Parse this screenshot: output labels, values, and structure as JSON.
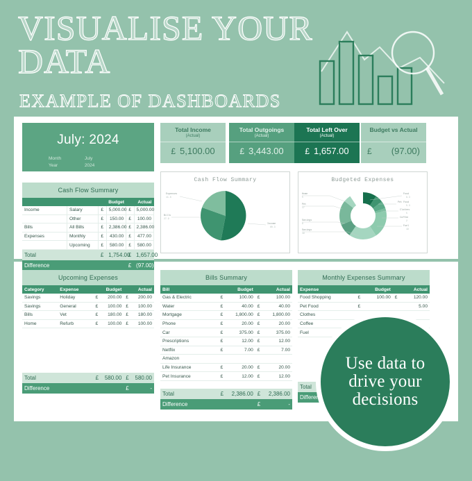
{
  "header": {
    "title": "VISUALISE YOUR\nDATA",
    "subtitle": "EXAMPLE OF  DASHBOARDS",
    "art_icon": "bar-chart-magnifier-icon"
  },
  "month_panel": {
    "title": "July: 2024",
    "rows": [
      {
        "label": "Month",
        "value": "July"
      },
      {
        "label": "Year",
        "value": "2024"
      }
    ]
  },
  "kpis": [
    {
      "title": "Total Income",
      "subtitle": "(Actual)",
      "currency": "£",
      "value": "5,100.00",
      "style": "light"
    },
    {
      "title": "Total Outgoings",
      "subtitle": "(Actual)",
      "currency": "£",
      "value": "3,443.00",
      "style": "mid"
    },
    {
      "title": "Total Left Over",
      "subtitle": "(Actual)",
      "currency": "£",
      "value": "1,657.00",
      "style": "dark"
    },
    {
      "title": "Budget vs Actual",
      "subtitle": "",
      "currency": "£",
      "value": "(97.00)",
      "style": "light"
    }
  ],
  "cashflow_table": {
    "caption": "Cash Flow Summary",
    "headers": [
      "",
      "",
      "",
      "Budget",
      "",
      "Actual"
    ],
    "rows": [
      [
        "Income",
        "Salary",
        "£",
        "5,000.00",
        "£",
        "5,000.00"
      ],
      [
        "",
        "Other",
        "£",
        "150.00",
        "£",
        "100.00"
      ],
      [
        "Bills",
        "All Bills",
        "£",
        "2,386.00",
        "£",
        "2,386.00"
      ],
      [
        "Expenses",
        "Monthly",
        "£",
        "430.00",
        "£",
        "477.00"
      ],
      [
        "",
        "Upcoming",
        "£",
        "580.00",
        "£",
        "580.00"
      ]
    ],
    "total": [
      "Total",
      "",
      "£",
      "1,754.00",
      "£",
      "1,657.00"
    ],
    "difference": [
      "Difference",
      "",
      "",
      "",
      "£",
      "(97.00)"
    ]
  },
  "upcoming_table": {
    "caption": "Upcoming Expenses",
    "headers": [
      "Category",
      "Expense",
      "",
      "Budget",
      "",
      "Actual"
    ],
    "rows": [
      [
        "Savings",
        "Holiday",
        "£",
        "200.00",
        "£",
        "200.00"
      ],
      [
        "Savings",
        "General",
        "£",
        "100.00",
        "£",
        "100.00"
      ],
      [
        "Bills",
        "Vet",
        "£",
        "180.00",
        "£",
        "180.00"
      ],
      [
        "Home",
        "Refurb",
        "£",
        "100.00",
        "£",
        "100.00"
      ]
    ],
    "total": [
      "Total",
      "",
      "£",
      "580.00",
      "£",
      "580.00"
    ],
    "difference": [
      "Difference",
      "",
      "",
      "",
      "£",
      "-"
    ]
  },
  "bills_table": {
    "caption": "Bills Summary",
    "headers": [
      "Bill",
      "",
      "Budget",
      "",
      "Actual"
    ],
    "rows": [
      [
        "Gas & Electric",
        "£",
        "100.00",
        "£",
        "100.00"
      ],
      [
        "Water",
        "£",
        "40.00",
        "£",
        "40.00"
      ],
      [
        "Mortgage",
        "£",
        "1,800.00",
        "£",
        "1,800.00"
      ],
      [
        "Phone",
        "£",
        "20.00",
        "£",
        "20.00"
      ],
      [
        "Car",
        "£",
        "375.00",
        "£",
        "375.00"
      ],
      [
        "Prescriptions",
        "£",
        "12.00",
        "£",
        "12.00"
      ],
      [
        "Netflix",
        "£",
        "7.00",
        "£",
        "7.00"
      ],
      [
        "Amazon",
        "",
        "",
        "",
        ""
      ],
      [
        "Life Insurance",
        "£",
        "20.00",
        "£",
        "20.00"
      ],
      [
        "Pet Insurance",
        "£",
        "12.00",
        "£",
        "12.00"
      ]
    ],
    "total": [
      "Total",
      "£",
      "2,386.00",
      "£",
      "2,386.00"
    ],
    "difference": [
      "Difference",
      "",
      "",
      "£",
      "-"
    ]
  },
  "monthly_table": {
    "caption": "Monthly Expenses Summary",
    "headers": [
      "Expense",
      "",
      "Budget",
      "",
      "Actual"
    ],
    "rows": [
      [
        "Food Shopping",
        "£",
        "100.00",
        "£",
        "120.00"
      ],
      [
        "Pet Food",
        "£",
        "",
        "",
        "5.00"
      ],
      [
        "Clothes",
        "",
        "",
        "",
        ""
      ],
      [
        "Coffee",
        "",
        "",
        "",
        ""
      ],
      [
        "Fuel",
        "",
        "",
        "",
        ""
      ]
    ],
    "total": [
      "Total",
      "",
      "",
      "",
      ""
    ],
    "difference": [
      "Difference",
      "",
      "",
      "",
      ""
    ]
  },
  "badge": {
    "text": "Use data to\ndrive your\ndecisions"
  },
  "chart_data": [
    {
      "type": "pie",
      "title": "Cash Flow Summary",
      "categories": [
        "Income",
        "Bills",
        "Expenses"
      ],
      "values": [
        60.3,
        27.9,
        11.8
      ],
      "unit": "%",
      "colors": [
        "#1f7a57",
        "#3f9470",
        "#7fbd9e"
      ],
      "legend": "callout-labels"
    },
    {
      "type": "pie",
      "title": "Budgeted Expenses",
      "variant": "donut",
      "categories": [
        "Food",
        "Pet Food",
        "Clothes",
        "Coffee",
        "Fuel",
        "Savings",
        "Savings",
        "Pet",
        "Home"
      ],
      "values": [
        9.3,
        5.3,
        5.0,
        2.0,
        19.0,
        19.0,
        9.0,
        17.0,
        5.0
      ],
      "unit": "%",
      "colors": [
        "#166f4c",
        "#3f9470",
        "#5cab89",
        "#76bc9c",
        "#8ecbae",
        "#9fd5bb",
        "#5ba083",
        "#79b89b",
        "#a5d6c0"
      ],
      "legend": "callout-labels"
    }
  ]
}
